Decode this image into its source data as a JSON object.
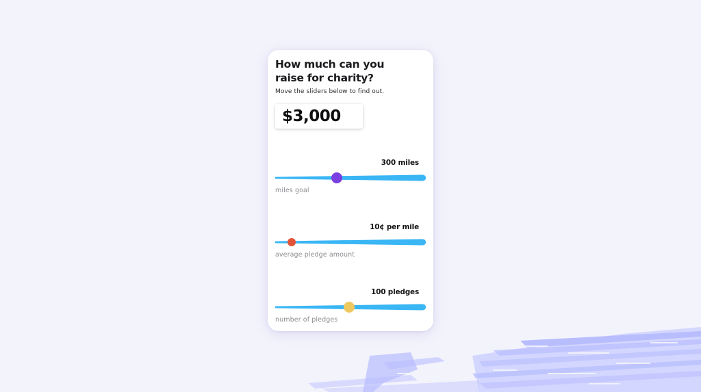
{
  "colors": {
    "background": "#f3f3fc",
    "card": "#ffffff",
    "track": "#3ab6f5",
    "brush": "#aeb4ff"
  },
  "calculator": {
    "title_line1": "How much can you",
    "title_line2": "raise for charity?",
    "subtitle": "Move the sliders below to find out.",
    "total": "$3,000"
  },
  "sliders": [
    {
      "value_text": "300 miles",
      "label": "miles goal",
      "position_fraction": 0.41,
      "thumb_color": "#7a3fe0"
    },
    {
      "value_text": "10¢ per mile",
      "label": "average pledge amount",
      "position_fraction": 0.11,
      "thumb_color": "#e2543a"
    },
    {
      "value_text": "100 pledges",
      "label": "number of pledges",
      "position_fraction": 0.49,
      "thumb_color": "#f0c860"
    }
  ]
}
